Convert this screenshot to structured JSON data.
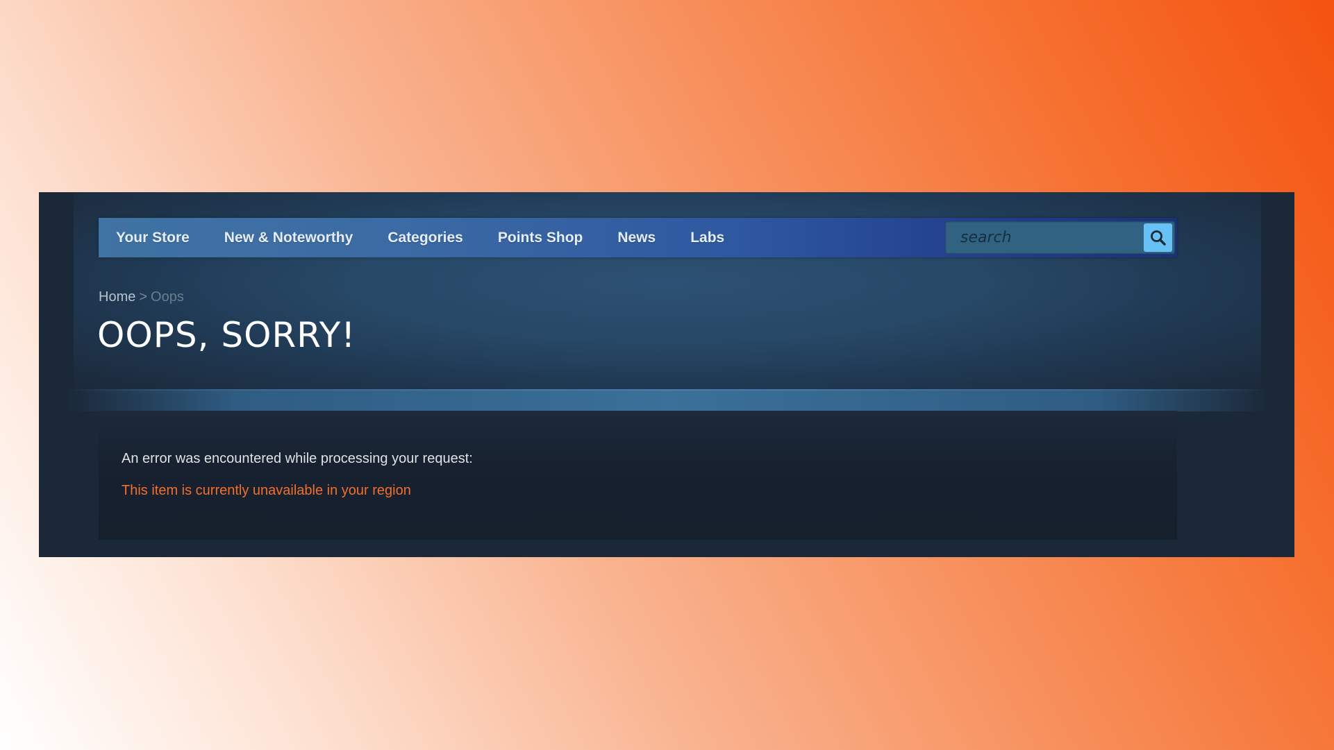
{
  "nav": {
    "items": [
      {
        "label": "Your Store"
      },
      {
        "label": "New & Noteworthy"
      },
      {
        "label": "Categories"
      },
      {
        "label": "Points Shop"
      },
      {
        "label": "News"
      },
      {
        "label": "Labs"
      }
    ]
  },
  "search": {
    "placeholder": "search",
    "button_icon": "search-icon"
  },
  "breadcrumb": {
    "home": "Home",
    "separator": ">",
    "current": "Oops"
  },
  "page": {
    "title": "OOPS, SORRY!"
  },
  "error": {
    "intro": "An error was encountered while processing your request:",
    "message": "This item is currently unavailable in your region"
  },
  "colors": {
    "page_background": "#1b2838",
    "nav_start": "#3f73a3",
    "nav_end": "#1a3275",
    "search_button": "#67c1f5",
    "error_text": "#f26f2c",
    "backdrop_accent": "#f45210"
  }
}
